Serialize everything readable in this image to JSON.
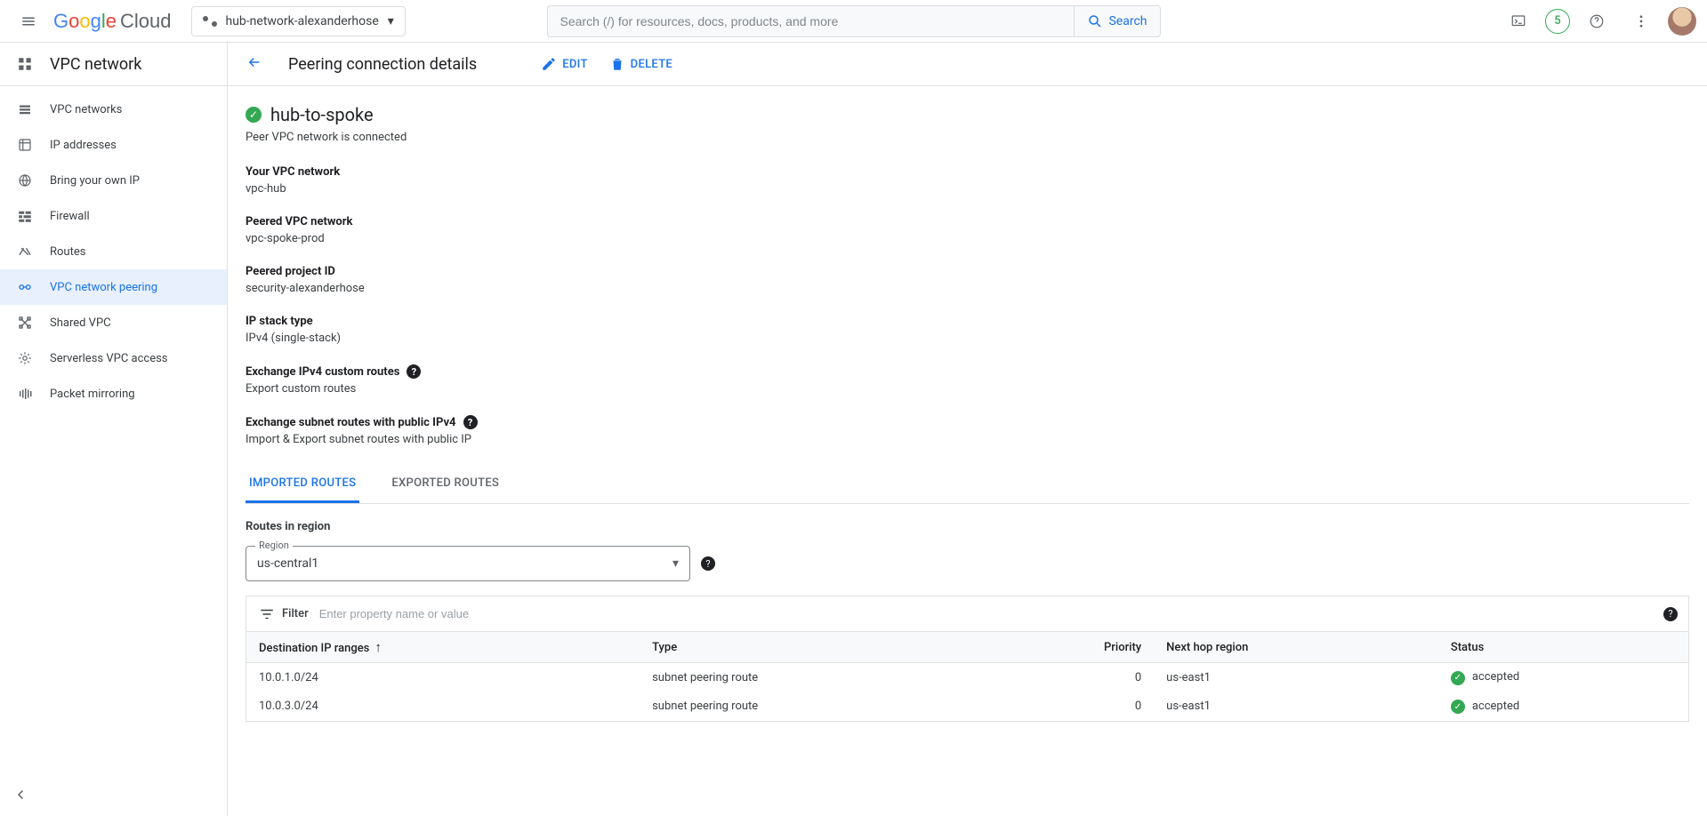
{
  "header": {
    "product": {
      "left": "Google",
      "right": "Cloud"
    },
    "project_name": "hub-network-alexanderhose",
    "search_placeholder": "Search (/) for resources, docs, products, and more",
    "search_button": "Search",
    "trial_badge": "5"
  },
  "leftnav": {
    "title": "VPC network",
    "items": [
      {
        "label": "VPC networks",
        "icon": "vpc-networks-icon",
        "active": false
      },
      {
        "label": "IP addresses",
        "icon": "ip-addresses-icon",
        "active": false
      },
      {
        "label": "Bring your own IP",
        "icon": "byoip-icon",
        "active": false
      },
      {
        "label": "Firewall",
        "icon": "firewall-icon",
        "active": false
      },
      {
        "label": "Routes",
        "icon": "routes-icon",
        "active": false
      },
      {
        "label": "VPC network peering",
        "icon": "peering-icon",
        "active": true
      },
      {
        "label": "Shared VPC",
        "icon": "shared-vpc-icon",
        "active": false
      },
      {
        "label": "Serverless VPC access",
        "icon": "serverless-icon",
        "active": false
      },
      {
        "label": "Packet mirroring",
        "icon": "mirroring-icon",
        "active": false
      }
    ]
  },
  "toolbar": {
    "title": "Peering connection details",
    "edit_label": "EDIT",
    "delete_label": "DELETE"
  },
  "detail": {
    "name": "hub-to-spoke",
    "status_text": "Peer VPC network is connected",
    "fields": [
      {
        "label": "Your VPC network",
        "value": "vpc-hub",
        "help": false
      },
      {
        "label": "Peered VPC network",
        "value": "vpc-spoke-prod",
        "help": false
      },
      {
        "label": "Peered project ID",
        "value": "security-alexanderhose",
        "help": false
      },
      {
        "label": "IP stack type",
        "value": "IPv4 (single-stack)",
        "help": false
      },
      {
        "label": "Exchange IPv4 custom routes",
        "value": "Export custom routes",
        "help": true
      },
      {
        "label": "Exchange subnet routes with public IPv4",
        "value": "Import & Export subnet routes with public IP",
        "help": true
      }
    ]
  },
  "tabs": [
    {
      "label": "IMPORTED ROUTES",
      "active": true
    },
    {
      "label": "EXPORTED ROUTES",
      "active": false
    }
  ],
  "routes_section": {
    "heading": "Routes in region",
    "region_field_label": "Region",
    "region_value": "us-central1",
    "filter_label": "Filter",
    "filter_placeholder": "Enter property name or value"
  },
  "table": {
    "columns": [
      {
        "label": "Destination IP ranges",
        "sort": "asc"
      },
      {
        "label": "Type"
      },
      {
        "label": "Priority",
        "align": "right"
      },
      {
        "label": "Next hop region"
      },
      {
        "label": "Status"
      }
    ],
    "rows": [
      {
        "dest": "10.0.1.0/24",
        "type": "subnet peering route",
        "priority": "0",
        "next_hop": "us-east1",
        "status": "accepted"
      },
      {
        "dest": "10.0.3.0/24",
        "type": "subnet peering route",
        "priority": "0",
        "next_hop": "us-east1",
        "status": "accepted"
      }
    ]
  }
}
